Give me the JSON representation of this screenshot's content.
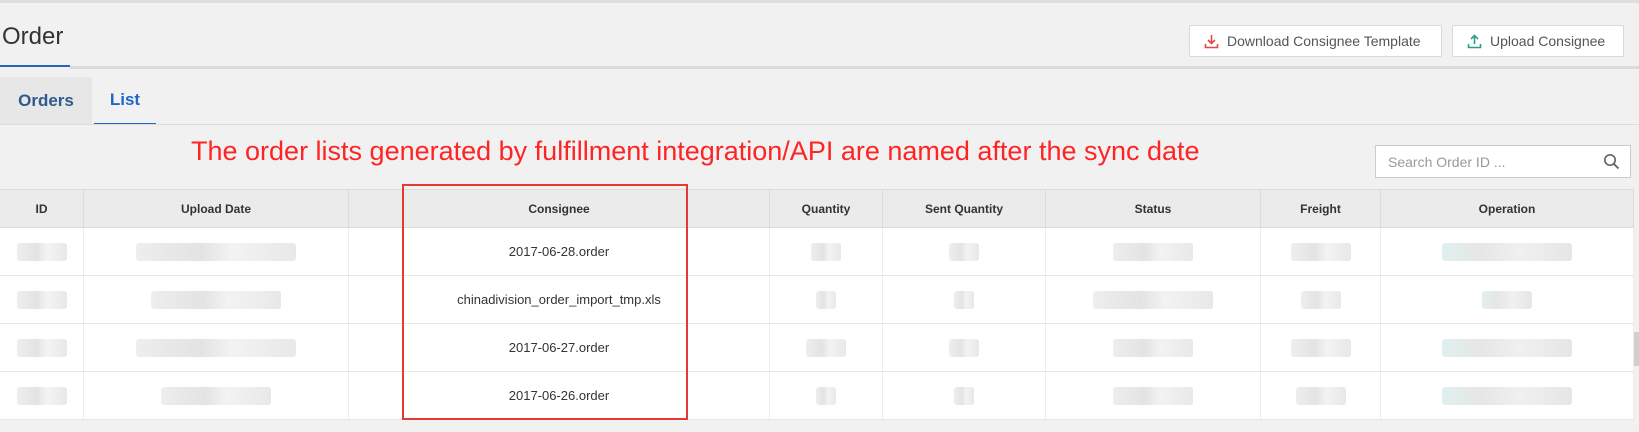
{
  "header": {
    "title": "Order",
    "download_button_label": "Download Consignee Template",
    "upload_button_label": "Upload Consignee"
  },
  "tabs": [
    {
      "label": "Orders",
      "active": false
    },
    {
      "label": "List",
      "active": true
    }
  ],
  "annotation": {
    "text": "The order lists generated by fulfillment integration/API are named after the sync date",
    "color": "#ff2424"
  },
  "search": {
    "placeholder": "Search Order ID ...",
    "value": ""
  },
  "table": {
    "columns": [
      "ID",
      "Upload Date",
      "Consignee",
      "Quantity",
      "Sent Quantity",
      "Status",
      "Freight",
      "Operation"
    ],
    "rows": [
      {
        "consignee": "2017-06-28.order"
      },
      {
        "consignee": "chinadivision_order_import_tmp.xls"
      },
      {
        "consignee": "2017-06-27.order"
      },
      {
        "consignee": "2017-06-26.order"
      }
    ]
  },
  "colors": {
    "accent": "#1f67c7",
    "highlight": "#e53935",
    "download_icon": "#e0474c",
    "upload_icon": "#2a9d8f"
  },
  "icons": {
    "download": "download-icon",
    "upload": "upload-icon",
    "search": "search-icon"
  }
}
